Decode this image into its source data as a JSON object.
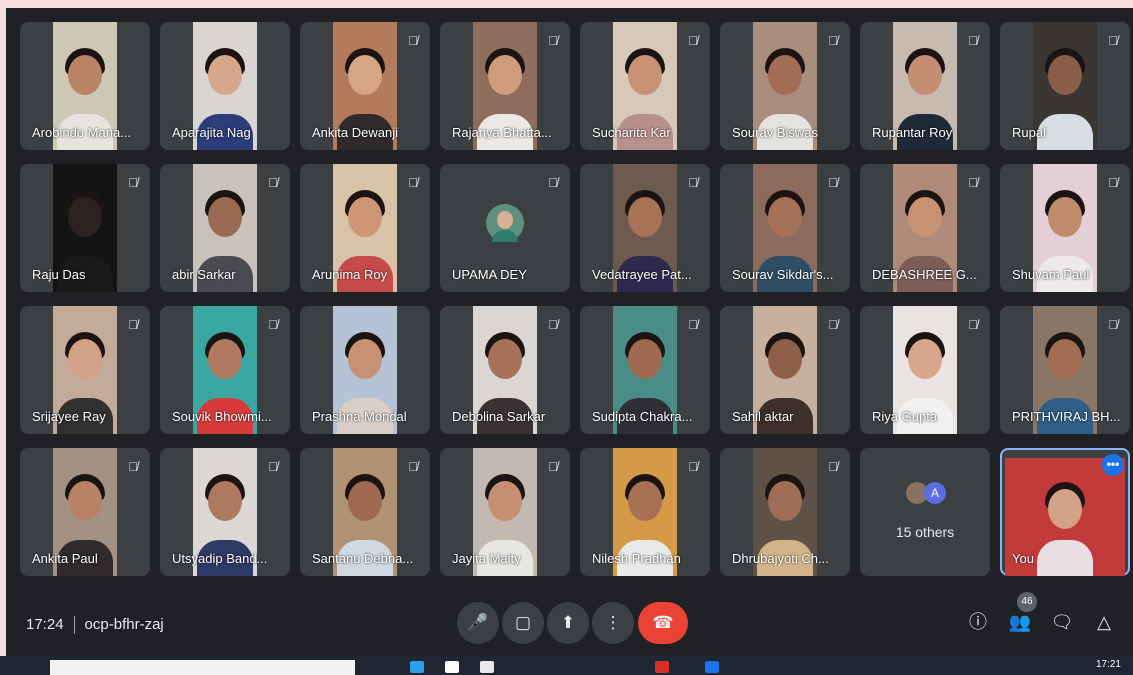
{
  "meeting": {
    "time": "17:24",
    "code": "ocp-bfhr-zaj",
    "participants_badge": "46"
  },
  "participants": [
    {
      "name": "Arobindo Mana...",
      "muted": false,
      "bg": "#cfc7b6",
      "skin": "#b98366",
      "shirt": "#e7e4df"
    },
    {
      "name": "Aparajita Nag",
      "muted": false,
      "bg": "#d8d5d2",
      "skin": "#d6a78a",
      "shirt": "#2c3d7a"
    },
    {
      "name": "Ankita Dewanji",
      "muted": true,
      "bg": "#b47a5c",
      "skin": "#d6a586",
      "shirt": "#2f2b2b"
    },
    {
      "name": "Rajanya Bhatta...",
      "muted": true,
      "bg": "#8f6c5b",
      "skin": "#cf9c7d",
      "shirt": "#ece8e6"
    },
    {
      "name": "Sucharita Kar",
      "muted": true,
      "bg": "#d6c9b9",
      "skin": "#c99276",
      "shirt": "#b78f8d"
    },
    {
      "name": "Sourav Biswas",
      "muted": true,
      "bg": "#a98e7d",
      "skin": "#a26d55",
      "shirt": "#e5e3df"
    },
    {
      "name": "Rupantar Roy",
      "muted": true,
      "bg": "#c7bbb1",
      "skin": "#c58d72",
      "shirt": "#1f2a38"
    },
    {
      "name": "Rupal",
      "muted": true,
      "bg": "#3a3634",
      "skin": "#8a5d48",
      "shirt": "#d8dde4"
    },
    {
      "name": "Raju Das",
      "muted": true,
      "bg": "#141313",
      "skin": "#2a2322",
      "shirt": "#1a1818"
    },
    {
      "name": "abir Sarkar",
      "muted": true,
      "bg": "#c9c2bb",
      "skin": "#9a6a52",
      "shirt": "#4a4b52"
    },
    {
      "name": "Arunima Roy",
      "muted": true,
      "bg": "#d8c3a8",
      "skin": "#cf9577",
      "shirt": "#c74a4a"
    },
    {
      "name": "UPAMA DEY",
      "muted": true,
      "audio_only": true
    },
    {
      "name": "Vedatrayee Pat...",
      "muted": true,
      "bg": "#6d5a4e",
      "skin": "#a87257",
      "shirt": "#2e2a4f"
    },
    {
      "name": "Sourav Sikdar's...",
      "muted": true,
      "bg": "#8c6b5c",
      "skin": "#a57257",
      "shirt": "#2f4e66"
    },
    {
      "name": "DEBASHREE G...",
      "muted": true,
      "bg": "#b08a79",
      "skin": "#c79274",
      "shirt": "#7d5d5a"
    },
    {
      "name": "Shuvam Paul",
      "muted": true,
      "bg": "#e3cfd6",
      "skin": "#c08a6d",
      "shirt": "#eeeaea"
    },
    {
      "name": "Srijayee Ray",
      "muted": true,
      "bg": "#c4aa98",
      "skin": "#d1a085",
      "shirt": "#333030"
    },
    {
      "name": "Souvik Bhowmi...",
      "muted": true,
      "bg": "#3aa7a2",
      "skin": "#b07b60",
      "shirt": "#d73a3a"
    },
    {
      "name": "Prashna Mondal",
      "muted": false,
      "bg": "#b6c3d6",
      "skin": "#c99173",
      "shirt": "#d9cfc6"
    },
    {
      "name": "Debolina Sarkar",
      "muted": true,
      "bg": "#d9d6d3",
      "skin": "#a77158",
      "shirt": "#3a3232"
    },
    {
      "name": "Sudipta Chakra...",
      "muted": true,
      "bg": "#4a8c86",
      "skin": "#a06a50",
      "shirt": "#2f2f35"
    },
    {
      "name": "Sahil aktar",
      "muted": true,
      "bg": "#c7b09d",
      "skin": "#8f5f47",
      "shirt": "#3d2f29"
    },
    {
      "name": "Riya Gupta",
      "muted": true,
      "bg": "#e9e3e1",
      "skin": "#d7a68b",
      "shirt": "#f2f0ef"
    },
    {
      "name": "PRITHVIRAJ BH...",
      "muted": true,
      "bg": "#8a7666",
      "skin": "#a16c52",
      "shirt": "#2f5f86"
    },
    {
      "name": "Ankita Paul",
      "muted": true,
      "bg": "#a39284",
      "skin": "#b88266",
      "shirt": "#2f2b2b"
    },
    {
      "name": "Utsyadip Band...",
      "muted": true,
      "bg": "#dad7d4",
      "skin": "#ad7a5f",
      "shirt": "#2e3a66"
    },
    {
      "name": "Santanu Debna...",
      "muted": true,
      "bg": "#b19272",
      "skin": "#a06a50",
      "shirt": "#cfd9e2"
    },
    {
      "name": "Jayita Maity",
      "muted": true,
      "bg": "#c4b9b0",
      "skin": "#c58f74",
      "shirt": "#e8e6e3"
    },
    {
      "name": "Nilesh Pradhan",
      "muted": true,
      "bg": "#d59a47",
      "skin": "#a87055",
      "shirt": "#e9e9ea"
    },
    {
      "name": "Dhrubajyoti Ch...",
      "muted": true,
      "bg": "#5e5148",
      "skin": "#9f6d55",
      "shirt": "#d3b48a"
    },
    {
      "name": "15 others",
      "others": true,
      "initial": "A"
    },
    {
      "name": "You",
      "self": true,
      "bg": "#c23a3a",
      "skin": "#d3a185",
      "shirt": "#e7dfe3"
    }
  ],
  "icons": {
    "mic": "mic-icon",
    "camera": "camera-icon",
    "present": "present-icon",
    "more": "more-options-icon",
    "hangup": "hang-up-icon",
    "info": "info-icon",
    "people": "people-icon",
    "chat": "chat-icon",
    "activities": "activities-icon"
  },
  "taskbar": {
    "clock": "17:21"
  }
}
